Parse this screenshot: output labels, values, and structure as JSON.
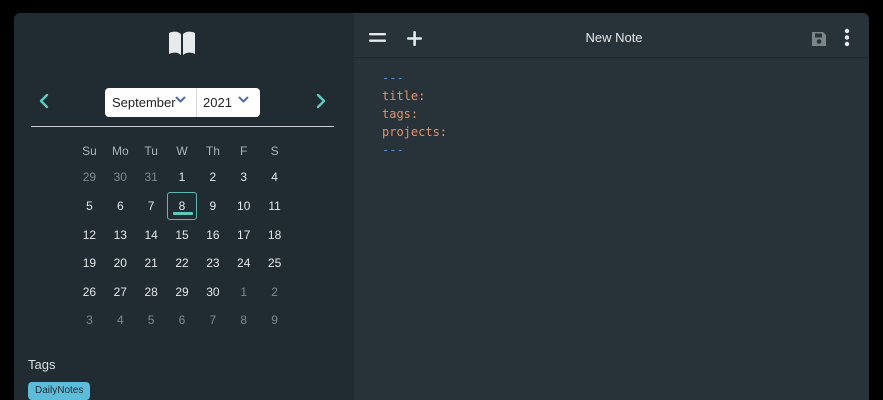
{
  "sidebar": {
    "logo_icon": "open-book-icon",
    "calendar": {
      "month": "September",
      "year": "2021",
      "weekdays": [
        "Su",
        "Mo",
        "Tu",
        "W",
        "Th",
        "F",
        "S"
      ],
      "weeks": [
        [
          "29",
          "30",
          "31",
          "1",
          "2",
          "3",
          "4"
        ],
        [
          "5",
          "6",
          "7",
          "8",
          "9",
          "10",
          "11"
        ],
        [
          "12",
          "13",
          "14",
          "15",
          "16",
          "17",
          "18"
        ],
        [
          "19",
          "20",
          "21",
          "22",
          "23",
          "24",
          "25"
        ],
        [
          "26",
          "27",
          "28",
          "29",
          "30",
          "1",
          "2"
        ],
        [
          "3",
          "4",
          "5",
          "6",
          "7",
          "8",
          "9"
        ]
      ],
      "selected_day": "8"
    },
    "tags": {
      "title": "Tags",
      "items": [
        "DailyNotes"
      ]
    }
  },
  "toolbar": {
    "title": "New Note",
    "icons": [
      "menu-icon",
      "plus-icon",
      "save-icon",
      "more-vertical-icon"
    ]
  },
  "editor": {
    "lines": [
      "---",
      "title:",
      "tags:",
      "projects:",
      "---"
    ]
  },
  "colors": {
    "sidebar_bg": "#212b32",
    "main_bg": "#283339",
    "accent_teal": "#5bcbc0",
    "tag_bg": "#5bbdd9",
    "frontmatter_key": "#e2916a",
    "frontmatter_delim": "#5d8fd1"
  }
}
